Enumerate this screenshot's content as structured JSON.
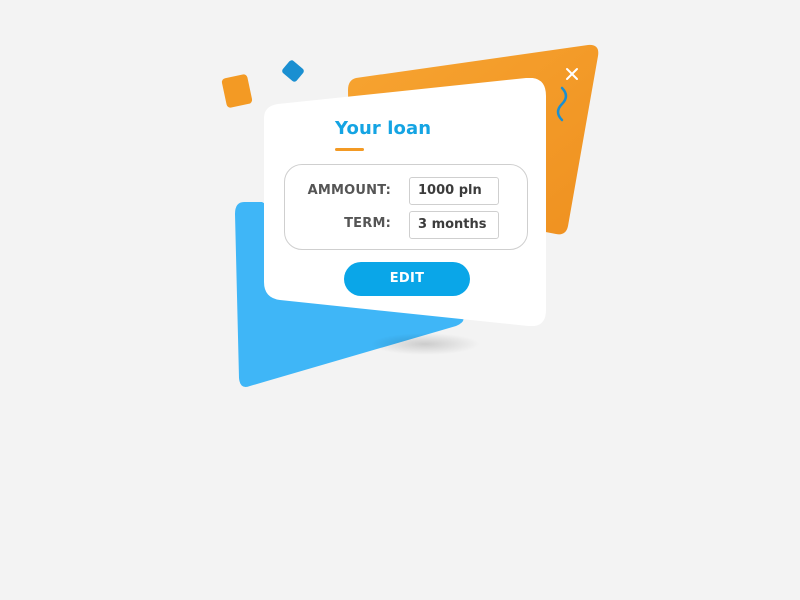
{
  "card": {
    "title": "Your loan",
    "fields": [
      {
        "label": "AMMOUNT:",
        "value": "1000 pln"
      },
      {
        "label": "TERM:",
        "value": "3 months"
      }
    ],
    "edit_label": "EDIT"
  },
  "icons": {
    "close": "close-icon",
    "squiggle": "squiggle-decoration"
  },
  "colors": {
    "accent_blue": "#14a4e3",
    "button_blue": "#0aa6e8",
    "shape_blue": "#3fb6f7",
    "shape_orange": "#f39a24",
    "small_square_blue": "#1a8fd1",
    "card_bg": "#ffffff",
    "page_bg": "#f3f3f3"
  }
}
